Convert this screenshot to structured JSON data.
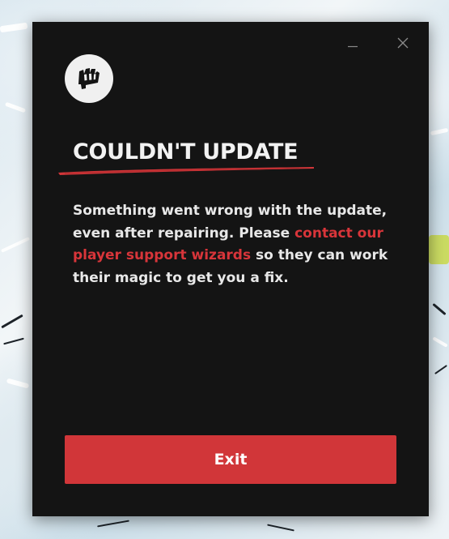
{
  "dialog": {
    "title": "COULDN'T UPDATE",
    "message_before_link": "Something went wrong with the update, even after repairing. Please ",
    "link_text": "contact our player support wizards",
    "message_after_link": " so they can work their magic to get you a fix.",
    "exit_label": "Exit"
  },
  "window_controls": {
    "minimize_icon": "minimize-icon",
    "close_icon": "close-icon"
  },
  "logo": {
    "icon": "riot-fist-icon"
  },
  "colors": {
    "dialog_background": "#141414",
    "accent_red": "#d13639",
    "link_red": "#d8353a",
    "text": "#e8e8e8",
    "logo_background": "#f0f0f0"
  }
}
